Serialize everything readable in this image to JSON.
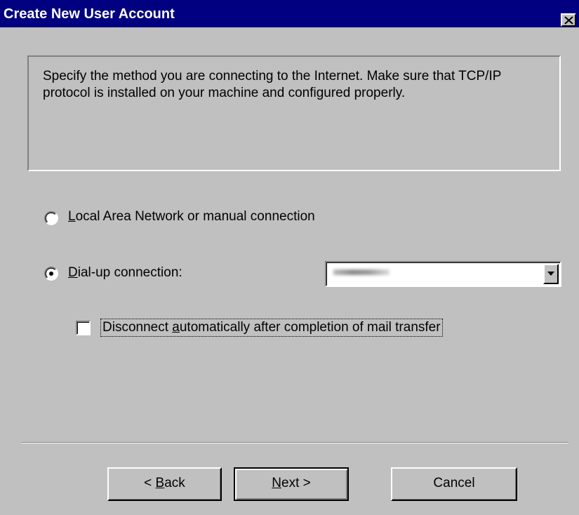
{
  "window": {
    "title": "Create New User Account",
    "close_icon": "close-icon"
  },
  "info": {
    "text": "Specify the method you are connecting to the Internet. Make sure that TCP/IP protocol is installed on your machine and configured properly."
  },
  "connection": {
    "lan_option": {
      "accel": "L",
      "rest": "ocal Area Network or manual connection",
      "selected": false
    },
    "dialup_option": {
      "accel": "D",
      "rest": "ial-up connection:",
      "selected": true
    },
    "dialup_combo": {
      "value_redacted": true,
      "dropdown_icon": "chevron-down-icon"
    }
  },
  "disconnect_checkbox": {
    "pre": "Disconnect ",
    "accel": "a",
    "rest": "utomatically after completion of mail transfer",
    "checked": false
  },
  "buttons": {
    "back": {
      "pre": "< ",
      "accel": "B",
      "rest": "ack"
    },
    "next": {
      "pre": "",
      "accel": "N",
      "rest": "ext  >"
    },
    "cancel": {
      "label": "Cancel"
    }
  }
}
